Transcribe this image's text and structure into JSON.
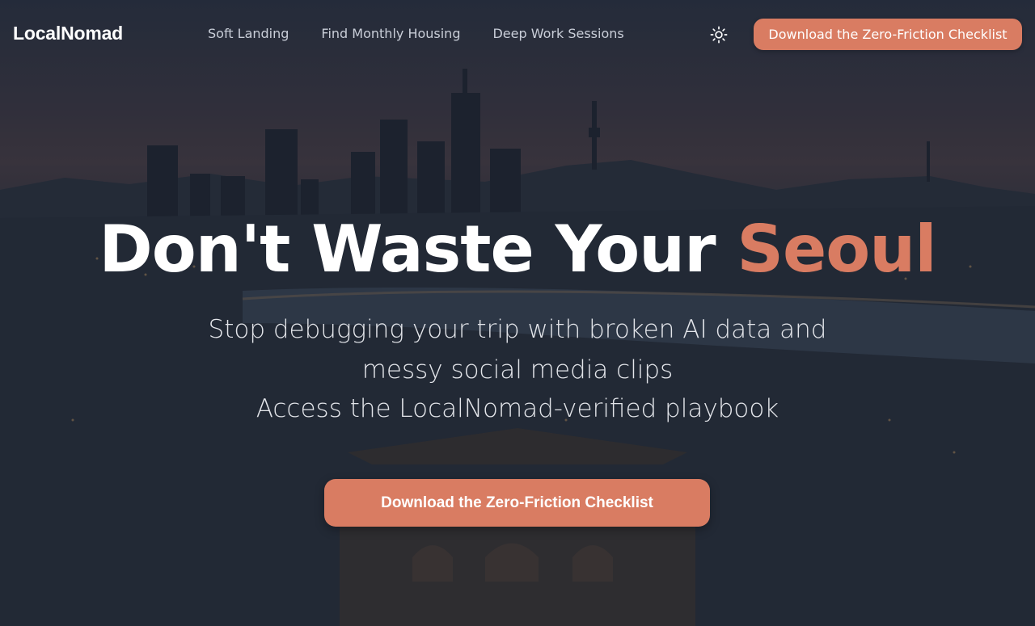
{
  "brand": {
    "name": "LocalNomad"
  },
  "nav": {
    "links": [
      {
        "label": "Soft Landing"
      },
      {
        "label": "Find Monthly Housing"
      },
      {
        "label": "Deep Work Sessions"
      }
    ],
    "theme_icon": "sun-icon",
    "cta_label": "Download the Zero-Friction Checklist"
  },
  "hero": {
    "headline_main": "Don't Waste Your ",
    "headline_accent": "Seoul",
    "subline_1": "Stop debugging your trip with broken AI data and",
    "subline_2": "messy social media clips",
    "subline_3": "Access the LocalNomad-verified playbook",
    "cta_label": "Download the Zero-Friction Checklist"
  },
  "colors": {
    "accent": "#d97c62",
    "text": "#ffffff",
    "nav_text": "#c9ced8"
  }
}
